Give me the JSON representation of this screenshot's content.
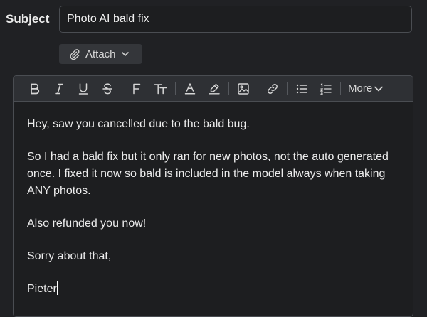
{
  "subject": {
    "label": "Subject",
    "value": "Photo AI bald fix"
  },
  "attach": {
    "label": "Attach"
  },
  "toolbar": {
    "more_label": "More",
    "buttons": [
      "bold-icon",
      "italic-icon",
      "underline-icon",
      "strikethrough-icon",
      "font-family-icon",
      "font-size-icon",
      "text-color-icon",
      "highlight-icon",
      "image-icon",
      "link-icon",
      "bulleted-list-icon",
      "numbered-list-icon"
    ]
  },
  "body": {
    "paragraphs": [
      "Hey, saw you cancelled due to the bald bug.",
      "So I had a bald fix but it only ran for new photos, not the auto generated once. I fixed it now so bald is included in the model always when taking ANY photos.",
      "Also refunded you now!",
      "Sorry about that,",
      "Pieter"
    ]
  }
}
